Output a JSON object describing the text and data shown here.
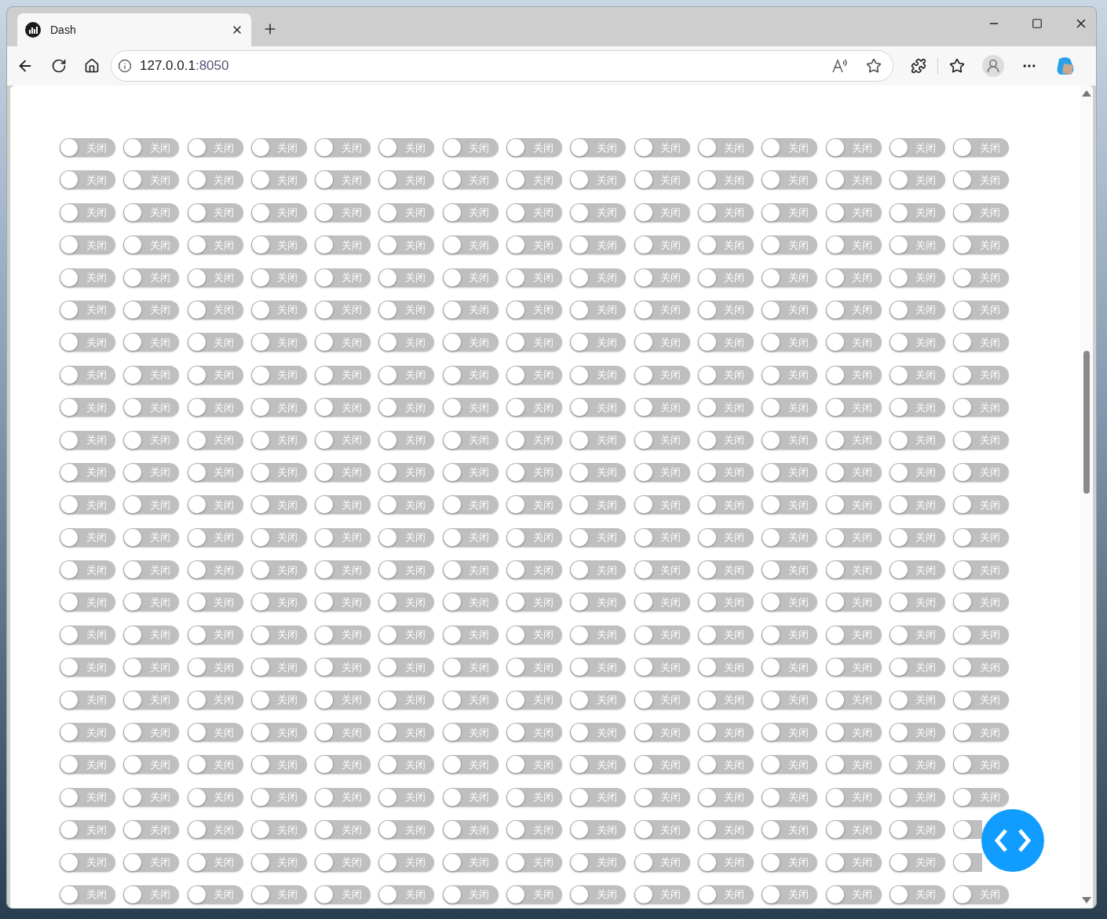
{
  "browser": {
    "tab": {
      "title": "Dash"
    },
    "address": {
      "host": "127.0.0.1",
      "port": ":8050"
    }
  },
  "switch_grid": [
    [
      {
        "label": "关闭",
        "checked": false
      },
      {
        "label": "关闭",
        "checked": false
      },
      {
        "label": "关闭",
        "checked": false
      },
      {
        "label": "关闭",
        "checked": false
      },
      {
        "label": "关闭",
        "checked": false
      },
      {
        "label": "关闭",
        "checked": false
      },
      {
        "label": "关闭",
        "checked": false
      },
      {
        "label": "关闭",
        "checked": false
      },
      {
        "label": "关闭",
        "checked": false
      },
      {
        "label": "关闭",
        "checked": false
      },
      {
        "label": "关闭",
        "checked": false
      },
      {
        "label": "关闭",
        "checked": false
      },
      {
        "label": "关闭",
        "checked": false
      },
      {
        "label": "关闭",
        "checked": false
      },
      {
        "label": "关闭",
        "checked": false
      }
    ],
    [
      {
        "label": "关闭",
        "checked": false
      },
      {
        "label": "关闭",
        "checked": false
      },
      {
        "label": "关闭",
        "checked": false
      },
      {
        "label": "关闭",
        "checked": false
      },
      {
        "label": "关闭",
        "checked": false
      },
      {
        "label": "关闭",
        "checked": false
      },
      {
        "label": "关闭",
        "checked": false
      },
      {
        "label": "关闭",
        "checked": false
      },
      {
        "label": "关闭",
        "checked": false
      },
      {
        "label": "关闭",
        "checked": false
      },
      {
        "label": "关闭",
        "checked": false
      },
      {
        "label": "关闭",
        "checked": false
      },
      {
        "label": "关闭",
        "checked": false
      },
      {
        "label": "关闭",
        "checked": false
      },
      {
        "label": "关闭",
        "checked": false
      }
    ],
    [
      {
        "label": "关闭",
        "checked": false
      },
      {
        "label": "关闭",
        "checked": false
      },
      {
        "label": "关闭",
        "checked": false
      },
      {
        "label": "关闭",
        "checked": false
      },
      {
        "label": "关闭",
        "checked": false
      },
      {
        "label": "关闭",
        "checked": false
      },
      {
        "label": "关闭",
        "checked": false
      },
      {
        "label": "关闭",
        "checked": false
      },
      {
        "label": "关闭",
        "checked": false
      },
      {
        "label": "关闭",
        "checked": false
      },
      {
        "label": "关闭",
        "checked": false
      },
      {
        "label": "关闭",
        "checked": false
      },
      {
        "label": "关闭",
        "checked": false
      },
      {
        "label": "关闭",
        "checked": false
      },
      {
        "label": "关闭",
        "checked": false
      }
    ],
    [
      {
        "label": "关闭",
        "checked": false
      },
      {
        "label": "关闭",
        "checked": false
      },
      {
        "label": "关闭",
        "checked": false
      },
      {
        "label": "关闭",
        "checked": false
      },
      {
        "label": "关闭",
        "checked": false
      },
      {
        "label": "关闭",
        "checked": false
      },
      {
        "label": "关闭",
        "checked": false
      },
      {
        "label": "关闭",
        "checked": false
      },
      {
        "label": "关闭",
        "checked": false
      },
      {
        "label": "关闭",
        "checked": false
      },
      {
        "label": "关闭",
        "checked": false
      },
      {
        "label": "关闭",
        "checked": false
      },
      {
        "label": "关闭",
        "checked": false
      },
      {
        "label": "关闭",
        "checked": false
      },
      {
        "label": "关闭",
        "checked": false
      }
    ],
    [
      {
        "label": "关闭",
        "checked": false
      },
      {
        "label": "关闭",
        "checked": false
      },
      {
        "label": "关闭",
        "checked": false
      },
      {
        "label": "关闭",
        "checked": false
      },
      {
        "label": "关闭",
        "checked": false
      },
      {
        "label": "关闭",
        "checked": false
      },
      {
        "label": "关闭",
        "checked": false
      },
      {
        "label": "关闭",
        "checked": false
      },
      {
        "label": "关闭",
        "checked": false
      },
      {
        "label": "关闭",
        "checked": false
      },
      {
        "label": "关闭",
        "checked": false
      },
      {
        "label": "关闭",
        "checked": false
      },
      {
        "label": "关闭",
        "checked": false
      },
      {
        "label": "关闭",
        "checked": false
      },
      {
        "label": "关闭",
        "checked": false
      }
    ],
    [
      {
        "label": "关闭",
        "checked": false
      },
      {
        "label": "关闭",
        "checked": false
      },
      {
        "label": "关闭",
        "checked": false
      },
      {
        "label": "关闭",
        "checked": false
      },
      {
        "label": "关闭",
        "checked": false
      },
      {
        "label": "关闭",
        "checked": false
      },
      {
        "label": "关闭",
        "checked": false
      },
      {
        "label": "关闭",
        "checked": false
      },
      {
        "label": "关闭",
        "checked": false
      },
      {
        "label": "关闭",
        "checked": false
      },
      {
        "label": "关闭",
        "checked": false
      },
      {
        "label": "关闭",
        "checked": false
      },
      {
        "label": "关闭",
        "checked": false
      },
      {
        "label": "关闭",
        "checked": false
      },
      {
        "label": "关闭",
        "checked": false
      }
    ],
    [
      {
        "label": "关闭",
        "checked": false
      },
      {
        "label": "关闭",
        "checked": false
      },
      {
        "label": "关闭",
        "checked": false
      },
      {
        "label": "关闭",
        "checked": false
      },
      {
        "label": "关闭",
        "checked": false
      },
      {
        "label": "关闭",
        "checked": false
      },
      {
        "label": "关闭",
        "checked": false
      },
      {
        "label": "关闭",
        "checked": false
      },
      {
        "label": "关闭",
        "checked": false
      },
      {
        "label": "关闭",
        "checked": false
      },
      {
        "label": "关闭",
        "checked": false
      },
      {
        "label": "关闭",
        "checked": false
      },
      {
        "label": "关闭",
        "checked": false
      },
      {
        "label": "关闭",
        "checked": false
      },
      {
        "label": "关闭",
        "checked": false
      }
    ],
    [
      {
        "label": "关闭",
        "checked": false
      },
      {
        "label": "关闭",
        "checked": false
      },
      {
        "label": "关闭",
        "checked": false
      },
      {
        "label": "关闭",
        "checked": false
      },
      {
        "label": "关闭",
        "checked": false
      },
      {
        "label": "关闭",
        "checked": false
      },
      {
        "label": "关闭",
        "checked": false
      },
      {
        "label": "关闭",
        "checked": false
      },
      {
        "label": "关闭",
        "checked": false
      },
      {
        "label": "关闭",
        "checked": false
      },
      {
        "label": "关闭",
        "checked": false
      },
      {
        "label": "关闭",
        "checked": false
      },
      {
        "label": "关闭",
        "checked": false
      },
      {
        "label": "关闭",
        "checked": false
      },
      {
        "label": "关闭",
        "checked": false
      }
    ],
    [
      {
        "label": "关闭",
        "checked": false
      },
      {
        "label": "关闭",
        "checked": false
      },
      {
        "label": "关闭",
        "checked": false
      },
      {
        "label": "关闭",
        "checked": false
      },
      {
        "label": "关闭",
        "checked": false
      },
      {
        "label": "关闭",
        "checked": false
      },
      {
        "label": "关闭",
        "checked": false
      },
      {
        "label": "关闭",
        "checked": false
      },
      {
        "label": "关闭",
        "checked": false
      },
      {
        "label": "关闭",
        "checked": false
      },
      {
        "label": "关闭",
        "checked": false
      },
      {
        "label": "关闭",
        "checked": false
      },
      {
        "label": "关闭",
        "checked": false
      },
      {
        "label": "关闭",
        "checked": false
      },
      {
        "label": "关闭",
        "checked": false
      }
    ],
    [
      {
        "label": "关闭",
        "checked": false
      },
      {
        "label": "关闭",
        "checked": false
      },
      {
        "label": "关闭",
        "checked": false
      },
      {
        "label": "关闭",
        "checked": false
      },
      {
        "label": "关闭",
        "checked": false
      },
      {
        "label": "关闭",
        "checked": false
      },
      {
        "label": "关闭",
        "checked": false
      },
      {
        "label": "关闭",
        "checked": false
      },
      {
        "label": "关闭",
        "checked": false
      },
      {
        "label": "关闭",
        "checked": false
      },
      {
        "label": "关闭",
        "checked": false
      },
      {
        "label": "关闭",
        "checked": false
      },
      {
        "label": "关闭",
        "checked": false
      },
      {
        "label": "关闭",
        "checked": false
      },
      {
        "label": "关闭",
        "checked": false
      }
    ],
    [
      {
        "label": "关闭",
        "checked": false
      },
      {
        "label": "关闭",
        "checked": false
      },
      {
        "label": "关闭",
        "checked": false
      },
      {
        "label": "关闭",
        "checked": false
      },
      {
        "label": "关闭",
        "checked": false
      },
      {
        "label": "关闭",
        "checked": false
      },
      {
        "label": "关闭",
        "checked": false
      },
      {
        "label": "关闭",
        "checked": false
      },
      {
        "label": "关闭",
        "checked": false
      },
      {
        "label": "关闭",
        "checked": false
      },
      {
        "label": "关闭",
        "checked": false
      },
      {
        "label": "关闭",
        "checked": false
      },
      {
        "label": "关闭",
        "checked": false
      },
      {
        "label": "关闭",
        "checked": false
      },
      {
        "label": "关闭",
        "checked": false
      }
    ],
    [
      {
        "label": "关闭",
        "checked": false
      },
      {
        "label": "关闭",
        "checked": false
      },
      {
        "label": "关闭",
        "checked": false
      },
      {
        "label": "关闭",
        "checked": false
      },
      {
        "label": "关闭",
        "checked": false
      },
      {
        "label": "关闭",
        "checked": false
      },
      {
        "label": "关闭",
        "checked": false
      },
      {
        "label": "关闭",
        "checked": false
      },
      {
        "label": "关闭",
        "checked": false
      },
      {
        "label": "关闭",
        "checked": false
      },
      {
        "label": "关闭",
        "checked": false
      },
      {
        "label": "关闭",
        "checked": false
      },
      {
        "label": "关闭",
        "checked": false
      },
      {
        "label": "关闭",
        "checked": false
      },
      {
        "label": "关闭",
        "checked": false
      }
    ],
    [
      {
        "label": "关闭",
        "checked": false
      },
      {
        "label": "关闭",
        "checked": false
      },
      {
        "label": "关闭",
        "checked": false
      },
      {
        "label": "关闭",
        "checked": false
      },
      {
        "label": "关闭",
        "checked": false
      },
      {
        "label": "关闭",
        "checked": false
      },
      {
        "label": "关闭",
        "checked": false
      },
      {
        "label": "关闭",
        "checked": false
      },
      {
        "label": "关闭",
        "checked": false
      },
      {
        "label": "关闭",
        "checked": false
      },
      {
        "label": "关闭",
        "checked": false
      },
      {
        "label": "关闭",
        "checked": false
      },
      {
        "label": "关闭",
        "checked": false
      },
      {
        "label": "关闭",
        "checked": false
      },
      {
        "label": "关闭",
        "checked": false
      }
    ],
    [
      {
        "label": "关闭",
        "checked": false
      },
      {
        "label": "关闭",
        "checked": false
      },
      {
        "label": "关闭",
        "checked": false
      },
      {
        "label": "关闭",
        "checked": false
      },
      {
        "label": "关闭",
        "checked": false
      },
      {
        "label": "关闭",
        "checked": false
      },
      {
        "label": "关闭",
        "checked": false
      },
      {
        "label": "关闭",
        "checked": false
      },
      {
        "label": "关闭",
        "checked": false
      },
      {
        "label": "关闭",
        "checked": false
      },
      {
        "label": "关闭",
        "checked": false
      },
      {
        "label": "关闭",
        "checked": false
      },
      {
        "label": "关闭",
        "checked": false
      },
      {
        "label": "关闭",
        "checked": false
      },
      {
        "label": "关闭",
        "checked": false
      }
    ],
    [
      {
        "label": "关闭",
        "checked": false
      },
      {
        "label": "关闭",
        "checked": false
      },
      {
        "label": "关闭",
        "checked": false
      },
      {
        "label": "关闭",
        "checked": false
      },
      {
        "label": "关闭",
        "checked": false
      },
      {
        "label": "关闭",
        "checked": false
      },
      {
        "label": "关闭",
        "checked": false
      },
      {
        "label": "关闭",
        "checked": false
      },
      {
        "label": "关闭",
        "checked": false
      },
      {
        "label": "关闭",
        "checked": false
      },
      {
        "label": "关闭",
        "checked": false
      },
      {
        "label": "关闭",
        "checked": false
      },
      {
        "label": "关闭",
        "checked": false
      },
      {
        "label": "关闭",
        "checked": false
      },
      {
        "label": "关闭",
        "checked": false
      }
    ],
    [
      {
        "label": "关闭",
        "checked": false
      },
      {
        "label": "关闭",
        "checked": false
      },
      {
        "label": "关闭",
        "checked": false
      },
      {
        "label": "关闭",
        "checked": false
      },
      {
        "label": "关闭",
        "checked": false
      },
      {
        "label": "关闭",
        "checked": false
      },
      {
        "label": "关闭",
        "checked": false
      },
      {
        "label": "关闭",
        "checked": false
      },
      {
        "label": "关闭",
        "checked": false
      },
      {
        "label": "关闭",
        "checked": false
      },
      {
        "label": "关闭",
        "checked": false
      },
      {
        "label": "关闭",
        "checked": false
      },
      {
        "label": "关闭",
        "checked": false
      },
      {
        "label": "关闭",
        "checked": false
      },
      {
        "label": "关闭",
        "checked": false
      }
    ],
    [
      {
        "label": "关闭",
        "checked": false
      },
      {
        "label": "关闭",
        "checked": false
      },
      {
        "label": "关闭",
        "checked": false
      },
      {
        "label": "关闭",
        "checked": false
      },
      {
        "label": "关闭",
        "checked": false
      },
      {
        "label": "关闭",
        "checked": false
      },
      {
        "label": "关闭",
        "checked": false
      },
      {
        "label": "关闭",
        "checked": false
      },
      {
        "label": "关闭",
        "checked": false
      },
      {
        "label": "关闭",
        "checked": false
      },
      {
        "label": "关闭",
        "checked": false
      },
      {
        "label": "关闭",
        "checked": false
      },
      {
        "label": "关闭",
        "checked": false
      },
      {
        "label": "关闭",
        "checked": false
      },
      {
        "label": "关闭",
        "checked": false
      }
    ],
    [
      {
        "label": "关闭",
        "checked": false
      },
      {
        "label": "关闭",
        "checked": false
      },
      {
        "label": "关闭",
        "checked": false
      },
      {
        "label": "关闭",
        "checked": false
      },
      {
        "label": "关闭",
        "checked": false
      },
      {
        "label": "关闭",
        "checked": false
      },
      {
        "label": "关闭",
        "checked": false
      },
      {
        "label": "关闭",
        "checked": false
      },
      {
        "label": "关闭",
        "checked": false
      },
      {
        "label": "关闭",
        "checked": false
      },
      {
        "label": "关闭",
        "checked": false
      },
      {
        "label": "关闭",
        "checked": false
      },
      {
        "label": "关闭",
        "checked": false
      },
      {
        "label": "关闭",
        "checked": false
      },
      {
        "label": "关闭",
        "checked": false
      }
    ],
    [
      {
        "label": "关闭",
        "checked": false
      },
      {
        "label": "关闭",
        "checked": false
      },
      {
        "label": "关闭",
        "checked": false
      },
      {
        "label": "关闭",
        "checked": false
      },
      {
        "label": "关闭",
        "checked": false
      },
      {
        "label": "关闭",
        "checked": false
      },
      {
        "label": "关闭",
        "checked": false
      },
      {
        "label": "关闭",
        "checked": false
      },
      {
        "label": "关闭",
        "checked": false
      },
      {
        "label": "关闭",
        "checked": false
      },
      {
        "label": "关闭",
        "checked": false
      },
      {
        "label": "关闭",
        "checked": false
      },
      {
        "label": "关闭",
        "checked": false
      },
      {
        "label": "关闭",
        "checked": false
      },
      {
        "label": "关闭",
        "checked": false
      }
    ],
    [
      {
        "label": "关闭",
        "checked": false
      },
      {
        "label": "关闭",
        "checked": false
      },
      {
        "label": "关闭",
        "checked": false
      },
      {
        "label": "关闭",
        "checked": false
      },
      {
        "label": "关闭",
        "checked": false
      },
      {
        "label": "关闭",
        "checked": false
      },
      {
        "label": "关闭",
        "checked": false
      },
      {
        "label": "关闭",
        "checked": false
      },
      {
        "label": "关闭",
        "checked": false
      },
      {
        "label": "关闭",
        "checked": false
      },
      {
        "label": "关闭",
        "checked": false
      },
      {
        "label": "关闭",
        "checked": false
      },
      {
        "label": "关闭",
        "checked": false
      },
      {
        "label": "关闭",
        "checked": false
      },
      {
        "label": "关闭",
        "checked": false
      }
    ],
    [
      {
        "label": "关闭",
        "checked": false
      },
      {
        "label": "关闭",
        "checked": false
      },
      {
        "label": "关闭",
        "checked": false
      },
      {
        "label": "关闭",
        "checked": false
      },
      {
        "label": "关闭",
        "checked": false
      },
      {
        "label": "关闭",
        "checked": false
      },
      {
        "label": "关闭",
        "checked": false
      },
      {
        "label": "关闭",
        "checked": false
      },
      {
        "label": "关闭",
        "checked": false
      },
      {
        "label": "关闭",
        "checked": false
      },
      {
        "label": "关闭",
        "checked": false
      },
      {
        "label": "关闭",
        "checked": false
      },
      {
        "label": "关闭",
        "checked": false
      },
      {
        "label": "关闭",
        "checked": false
      },
      {
        "label": "关闭",
        "checked": false
      }
    ],
    [
      {
        "label": "关闭",
        "checked": false
      },
      {
        "label": "关闭",
        "checked": false
      },
      {
        "label": "关闭",
        "checked": false
      },
      {
        "label": "关闭",
        "checked": false
      },
      {
        "label": "关闭",
        "checked": false
      },
      {
        "label": "关闭",
        "checked": false
      },
      {
        "label": "关闭",
        "checked": false
      },
      {
        "label": "关闭",
        "checked": false
      },
      {
        "label": "关闭",
        "checked": false
      },
      {
        "label": "关闭",
        "checked": false
      },
      {
        "label": "关闭",
        "checked": false
      },
      {
        "label": "关闭",
        "checked": false
      },
      {
        "label": "关闭",
        "checked": false
      },
      {
        "label": "关闭",
        "checked": false
      },
      {
        "checked": false
      }
    ],
    [
      {
        "label": "关闭",
        "checked": false
      },
      {
        "label": "关闭",
        "checked": false
      },
      {
        "label": "关闭",
        "checked": false
      },
      {
        "label": "关闭",
        "checked": false
      },
      {
        "label": "关闭",
        "checked": false
      },
      {
        "label": "关闭",
        "checked": false
      },
      {
        "label": "关闭",
        "checked": false
      },
      {
        "label": "关闭",
        "checked": false
      },
      {
        "label": "关闭",
        "checked": false
      },
      {
        "label": "关闭",
        "checked": false
      },
      {
        "label": "关闭",
        "checked": false
      },
      {
        "label": "关闭",
        "checked": false
      },
      {
        "label": "关闭",
        "checked": false
      },
      {
        "label": "关闭",
        "checked": false
      },
      {
        "checked": false
      }
    ],
    [
      {
        "label": "关闭",
        "checked": false
      },
      {
        "label": "关闭",
        "checked": false
      },
      {
        "label": "关闭",
        "checked": false
      },
      {
        "label": "关闭",
        "checked": false
      },
      {
        "label": "关闭",
        "checked": false
      },
      {
        "label": "关闭",
        "checked": false
      },
      {
        "label": "关闭",
        "checked": false
      },
      {
        "label": "关闭",
        "checked": false
      },
      {
        "label": "关闭",
        "checked": false
      },
      {
        "label": "关闭",
        "checked": false
      },
      {
        "label": "关闭",
        "checked": false
      },
      {
        "label": "关闭",
        "checked": false
      },
      {
        "label": "关闭",
        "checked": false
      },
      {
        "label": "关闭",
        "checked": false
      },
      {
        "label": "关闭",
        "checked": false
      }
    ]
  ]
}
